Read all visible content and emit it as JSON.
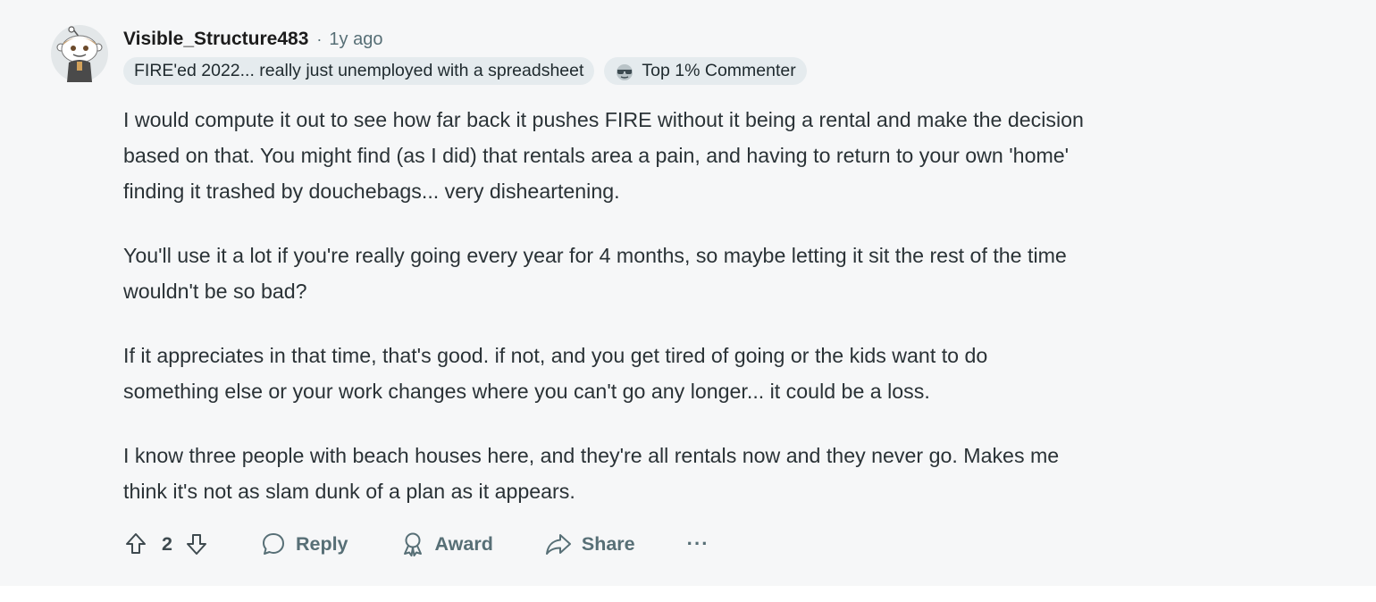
{
  "comment": {
    "author": "Visible_Structure483",
    "separator": "·",
    "timestamp": "1y ago",
    "user_flair": "FIRE'ed 2022... really just unemployed with a spreadsheet",
    "achievement_flair": "Top 1% Commenter",
    "paragraphs": [
      "I would compute it out to see how far back it pushes FIRE without it being a rental and make the decision\nbased on that. You might find (as I did) that rentals area a pain, and having to return to your own 'home'\nfinding it trashed by douchebags... very disheartening.",
      "You'll use it a lot if you're really going every year for 4 months, so maybe letting it sit the rest of the time\nwouldn't be so bad?",
      "If it appreciates in that time, that's good. if not, and you get tired of going or the kids want to do\nsomething else or your work changes where you can't go any longer... it could be a loss.",
      "I know three people with beach houses here, and they're all rentals now and they never go. Makes me\nthink it's not as slam dunk of a plan as it appears."
    ],
    "score": "2",
    "actions": {
      "reply": "Reply",
      "award": "Award",
      "share": "Share",
      "more": "···"
    }
  },
  "icons": {
    "avatar": "snoo-avatar",
    "achievement": "sunglasses-icon",
    "upvote": "arrow-up-icon",
    "downvote": "arrow-down-icon",
    "reply": "speech-bubble-icon",
    "award": "award-ribbon-icon",
    "share": "share-arrow-icon"
  },
  "colors": {
    "background": "#f6f7f8",
    "flair_background": "#e5ebee",
    "meta_text": "#576f76"
  }
}
